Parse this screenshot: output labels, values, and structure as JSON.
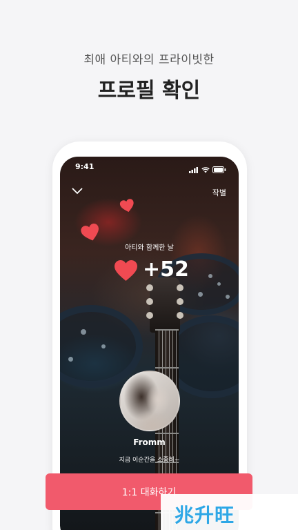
{
  "header": {
    "subtitle": "최애 아티와의 프라이빗한",
    "title": "프로필 확인"
  },
  "phone": {
    "status_time": "9:41",
    "close_label": "작별",
    "days_label": "아티와 함께한 날",
    "heart_count": "+52",
    "artist_name": "Fromm",
    "status_message": "지금 이순간을 소중히~"
  },
  "cta": {
    "label": "1:1 대화하기"
  },
  "watermark": {
    "text": "兆升旺"
  },
  "colors": {
    "accent": "#f15a6c",
    "heart": "#f04a52",
    "background": "#f5f5f7"
  }
}
